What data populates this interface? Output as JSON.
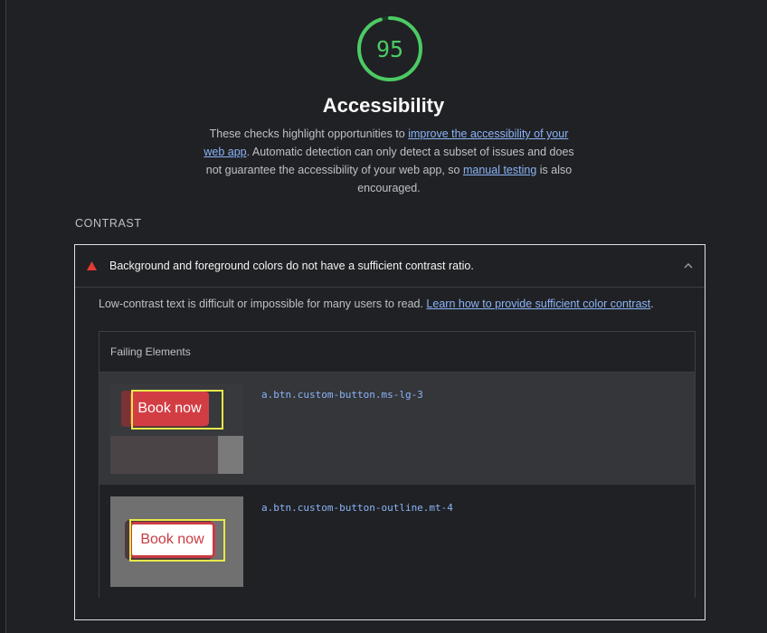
{
  "category": {
    "score": "95",
    "score_fraction": 0.95,
    "score_color": "#4cca64",
    "title": "Accessibility",
    "description": {
      "text_1": "These checks highlight opportunities to ",
      "link_1": "improve the accessibility of your web app",
      "text_2": ". Automatic detection can only detect a subset of issues and does not guarantee the accessibility of your web app, so ",
      "link_2": "manual testing",
      "text_3": " is also encouraged."
    }
  },
  "group": {
    "title": "CONTRAST"
  },
  "audit": {
    "status_icon": "fail-triangle-icon",
    "status_color": "#e53935",
    "title": "Background and foreground colors do not have a sufficient contrast ratio.",
    "expanded": true,
    "expand_icon": "chevron-up-icon",
    "description_text": "Low-contrast text is difficult or impossible for many users to read. ",
    "description_link": "Learn how to provide sufficient color contrast",
    "description_tail": ".",
    "details": {
      "header": "Failing Elements",
      "items": [
        {
          "thumbnail_label": "Book now",
          "selector": "a.btn.custom-button.ms-lg-3"
        },
        {
          "thumbnail_label": "Book now",
          "selector": "a.btn.custom-button-outline.mt-4"
        }
      ]
    }
  }
}
